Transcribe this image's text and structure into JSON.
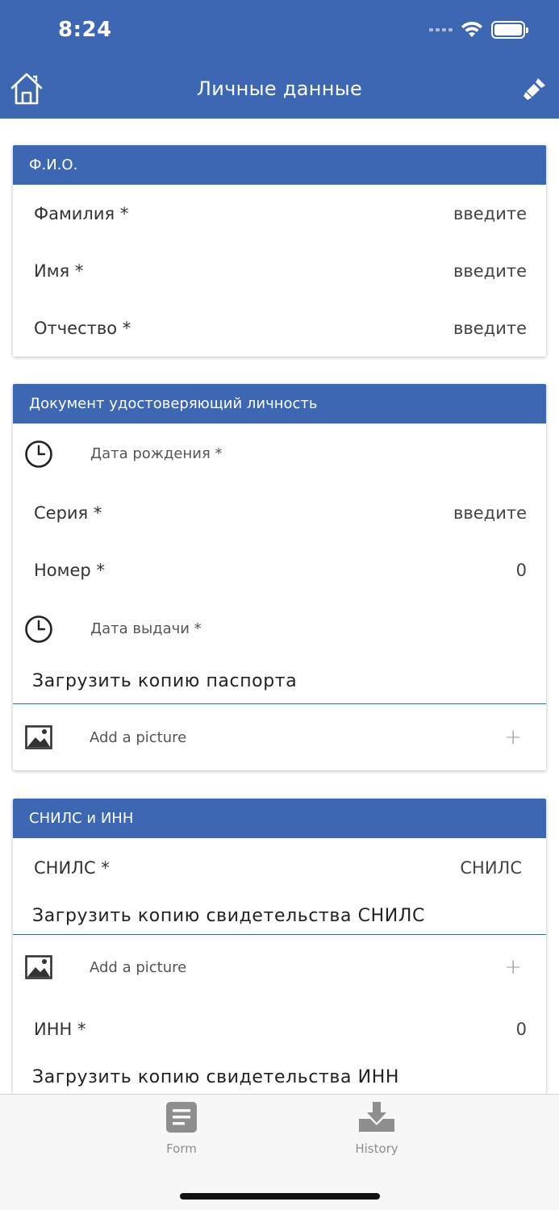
{
  "status_bar": {
    "time": "8:24"
  },
  "nav": {
    "title": "Личные данные"
  },
  "fio_card": {
    "header": "Ф.И.О.",
    "rows": [
      {
        "label": "Фамилия *",
        "value": "введите"
      },
      {
        "label": "Имя *",
        "value": "введите"
      },
      {
        "label": "Отчество *",
        "value": "введите"
      }
    ]
  },
  "doc_card": {
    "header": "Документ удостоверяющий личность",
    "birth_date_label": "Дата рождения *",
    "series": {
      "label": "Серия *",
      "value": "введите"
    },
    "number": {
      "label": "Номер *",
      "value": "0"
    },
    "issue_date_label": "Дата выдачи *",
    "upload_title": "Загрузить копию паспорта",
    "add_picture": "Add a picture",
    "plus": "+"
  },
  "snils_card": {
    "header": "СНИЛС и ИНН",
    "snils": {
      "label": "СНИЛС *",
      "value": "СНИЛС"
    },
    "snils_upload_title": "Загрузить копию свидетельства СНИЛС",
    "add_picture": "Add a picture",
    "plus": "+",
    "inn": {
      "label": "ИНН *",
      "value": "0"
    },
    "inn_upload_title": "Загрузить копию свидетельства ИНН"
  },
  "tabbar": {
    "tabs": [
      {
        "label": "Form",
        "icon": "document-icon"
      },
      {
        "label": "History",
        "icon": "download-tray-icon"
      }
    ]
  },
  "colors": {
    "accent": "#3e67b3",
    "tab_gray": "#8e8e8e"
  }
}
